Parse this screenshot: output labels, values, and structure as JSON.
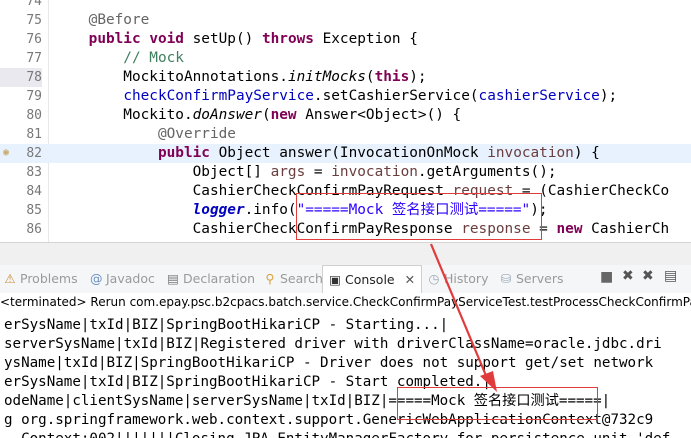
{
  "editor": {
    "lines": [
      {
        "num": "74",
        "segs": []
      },
      {
        "num": "75",
        "segs": [
          {
            "t": "    @Before",
            "c": "ann"
          }
        ]
      },
      {
        "num": "76",
        "segs": [
          {
            "t": "    ",
            "c": ""
          },
          {
            "t": "public",
            "c": "kw"
          },
          {
            "t": " ",
            "c": ""
          },
          {
            "t": "void",
            "c": "kw"
          },
          {
            "t": " setUp() ",
            "c": ""
          },
          {
            "t": "throws",
            "c": "kw"
          },
          {
            "t": " Exception {",
            "c": ""
          }
        ]
      },
      {
        "num": "77",
        "segs": [
          {
            "t": "        // Mock",
            "c": "cm"
          }
        ]
      },
      {
        "num": "78",
        "segs": [
          {
            "t": "        MockitoAnnotations.",
            "c": ""
          },
          {
            "t": "initMocks",
            "c": "it"
          },
          {
            "t": "(",
            "c": ""
          },
          {
            "t": "this",
            "c": "kw"
          },
          {
            "t": ");",
            "c": ""
          }
        ]
      },
      {
        "num": "79",
        "segs": [
          {
            "t": "        ",
            "c": ""
          },
          {
            "t": "checkConfirmPayService",
            "c": "fld"
          },
          {
            "t": ".setCashierService(",
            "c": ""
          },
          {
            "t": "cashierService",
            "c": "fld"
          },
          {
            "t": ");",
            "c": ""
          }
        ]
      },
      {
        "num": "80",
        "segs": [
          {
            "t": "        Mockito.",
            "c": ""
          },
          {
            "t": "doAnswer",
            "c": "it"
          },
          {
            "t": "(",
            "c": ""
          },
          {
            "t": "new",
            "c": "kw"
          },
          {
            "t": " Answer<Object>() {",
            "c": ""
          }
        ]
      },
      {
        "num": "81",
        "segs": [
          {
            "t": "            @Override",
            "c": "ann"
          }
        ]
      },
      {
        "num": "82",
        "segs": [
          {
            "t": "            ",
            "c": ""
          },
          {
            "t": "public",
            "c": "kw"
          },
          {
            "t": " Object answer(InvocationOnMock ",
            "c": ""
          },
          {
            "t": "invocation",
            "c": "cm2"
          },
          {
            "t": ") {",
            "c": ""
          }
        ]
      },
      {
        "num": "83",
        "segs": [
          {
            "t": "                Object[] ",
            "c": ""
          },
          {
            "t": "args",
            "c": "cm2"
          },
          {
            "t": " = ",
            "c": ""
          },
          {
            "t": "invocation",
            "c": "cm2"
          },
          {
            "t": ".getArguments();",
            "c": ""
          }
        ]
      },
      {
        "num": "84",
        "segs": [
          {
            "t": "                CashierCheckConfirmPayRequest ",
            "c": ""
          },
          {
            "t": "request",
            "c": "cm2"
          },
          {
            "t": " = (CashierCheckCo",
            "c": ""
          }
        ]
      },
      {
        "num": "85",
        "segs": [
          {
            "t": "                ",
            "c": ""
          },
          {
            "t": "logger",
            "c": "fldi"
          },
          {
            "t": ".info(",
            "c": ""
          },
          {
            "t": "\"=====Mock 签名接口测试=====\"",
            "c": "str"
          },
          {
            "t": ");",
            "c": ""
          }
        ]
      },
      {
        "num": "86",
        "segs": [
          {
            "t": "                CashierCheckConfirmPayResponse ",
            "c": ""
          },
          {
            "t": "response",
            "c": "cm2"
          },
          {
            "t": " = ",
            "c": ""
          },
          {
            "t": "new",
            "c": "kw"
          },
          {
            "t": " CashierCh",
            "c": ""
          }
        ]
      }
    ]
  },
  "views": {
    "tabs": [
      {
        "label": "Problems",
        "icon": "problems-icon"
      },
      {
        "label": "Javadoc",
        "icon": "javadoc-icon"
      },
      {
        "label": "Declaration",
        "icon": "declaration-icon"
      },
      {
        "label": "Search",
        "icon": "search-icon"
      },
      {
        "label": "Console",
        "icon": "console-icon",
        "close": "✕"
      },
      {
        "label": "History",
        "icon": "history-icon"
      },
      {
        "label": "Servers",
        "icon": "servers-icon"
      }
    ]
  },
  "console": {
    "status": "<terminated> Rerun com.epay.psc.b2cpacs.batch.service.CheckConfirmPayServiceTest.testProcessCheckConfirmPay [JU",
    "lines": [
      "erSysName|txId|BIZ|SpringBootHikariCP - Starting...|",
      "serverSysName|txId|BIZ|Registered driver with driverClassName=oracle.jdbc.dri",
      "ysName|txId|BIZ|SpringBootHikariCP - Driver does not support get/set network",
      "erSysName|txId|BIZ|SpringBootHikariCP - Start completed.|",
      "odeName|clientSysName|serverSysName|txId|BIZ|=====Mock 签名接口测试=====|",
      "g org.springframework.web.context.support.GenericWebApplicationContext@732c9",
      "  Context:002|||||||Closing JPA EntityManagerFactory for persistence unit 'def"
    ]
  },
  "colors": {
    "annotation": "#e03c3c",
    "keyword": "#7f0055",
    "string": "#2a00ff",
    "field": "#0000c0"
  }
}
